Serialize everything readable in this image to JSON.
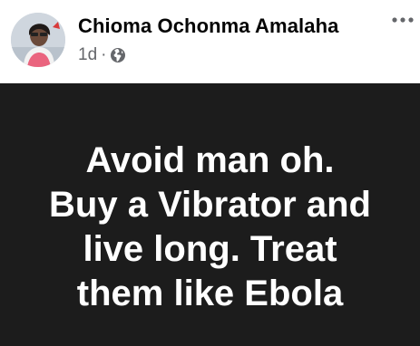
{
  "post": {
    "author_name": "Chioma Ochonma Amalaha",
    "timestamp": "1d",
    "separator": "·",
    "audience_icon": "globe-icon",
    "more_icon": "more-options-icon",
    "background_color": "#1c1c1c",
    "text_lines": [
      "Avoid man oh.",
      "Buy a Vibrator and",
      "live long. Treat",
      "them like Ebola"
    ]
  }
}
